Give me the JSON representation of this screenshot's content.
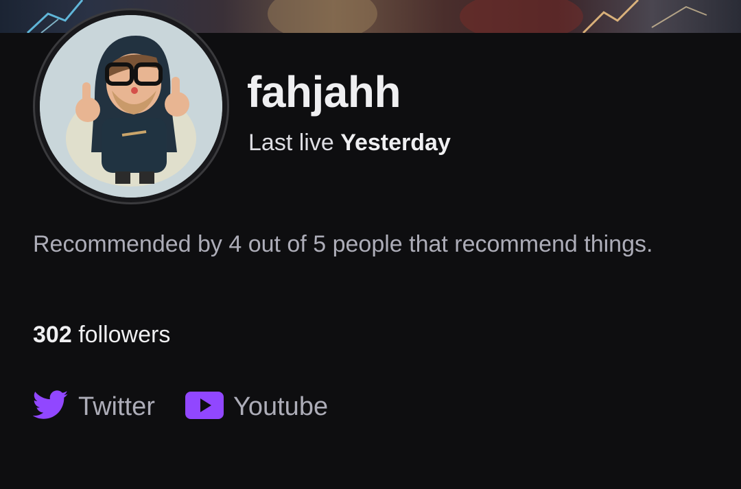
{
  "banner": {
    "description_icon": "banner-art"
  },
  "profile": {
    "avatar_icon": "cartoon-hooded-character-avatar",
    "username": "fahjahh",
    "last_live_prefix": "Last live",
    "last_live_value": "Yesterday",
    "bio": "Recommended by 4 out of 5 people that recommend things.",
    "followers_count": "302",
    "followers_label": "followers"
  },
  "social_links": [
    {
      "label": "Twitter",
      "icon": "twitter-bird-icon"
    },
    {
      "label": "Youtube",
      "icon": "youtube-play-icon"
    }
  ],
  "colors": {
    "background": "#0e0e10",
    "accent": "#9147ff",
    "text_primary": "#efeff1",
    "text_secondary": "#adadb8"
  }
}
